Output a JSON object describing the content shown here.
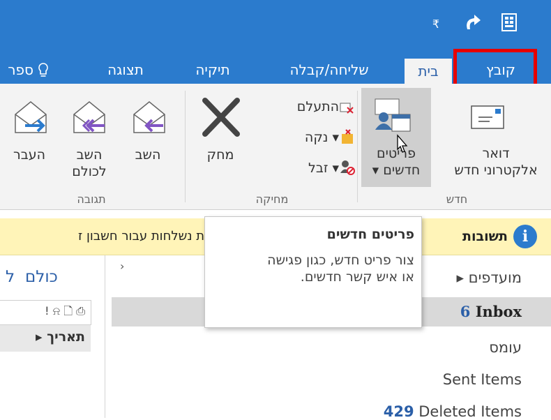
{
  "quick_access": {
    "dropdown_glyph": "₤",
    "redo_icon": "redo-icon",
    "touch_icon": "touch-mode-icon"
  },
  "tabs": {
    "file": "קובץ",
    "home": "בית",
    "send_receive": "שליחה/קבלה",
    "folder": "תיקיה",
    "view": "תצוגה",
    "tell_me": "ספר"
  },
  "ribbon": {
    "new_email": {
      "line1": "דואר",
      "line2": "אלקטרוני חדש"
    },
    "new_items": {
      "line1": "פריטים",
      "line2": "חדשים",
      "arrow": "▾"
    },
    "group_new": "חדש",
    "ignore": "התעלם",
    "clean_up": "נקה",
    "junk": "זבל",
    "delete": "מחק",
    "group_delete": "מחיקה",
    "reply": "השב",
    "reply_all": {
      "line1": "השב",
      "line2": "לכולם"
    },
    "forward": "העבר",
    "group_respond": "תגובה"
  },
  "infobar": {
    "title": "תשובות",
    "message": "ות נשלחות עבור חשבון ז"
  },
  "tooltip": {
    "title": "פריטים חדשים",
    "body": "צור פריט חדש, כגון פגישה או איש קשר חדשים."
  },
  "folders": {
    "favorites": "▸ מועדפים",
    "inbox_count": "6",
    "inbox_name": "Inbox",
    "omes": "עומס",
    "sent": "Sent Items",
    "deleted_count": "429",
    "deleted_name": "Deleted Items"
  },
  "mail_list": {
    "filter_all": "כולם",
    "filter_cut": "ל",
    "sort_label": "תאריך",
    "header_icons": "! ⍾ 🗋 ⎙"
  },
  "colors": {
    "accent": "#2b7bcd",
    "highlight_box": "#e60000",
    "infobar_bg": "#fff4b8"
  }
}
